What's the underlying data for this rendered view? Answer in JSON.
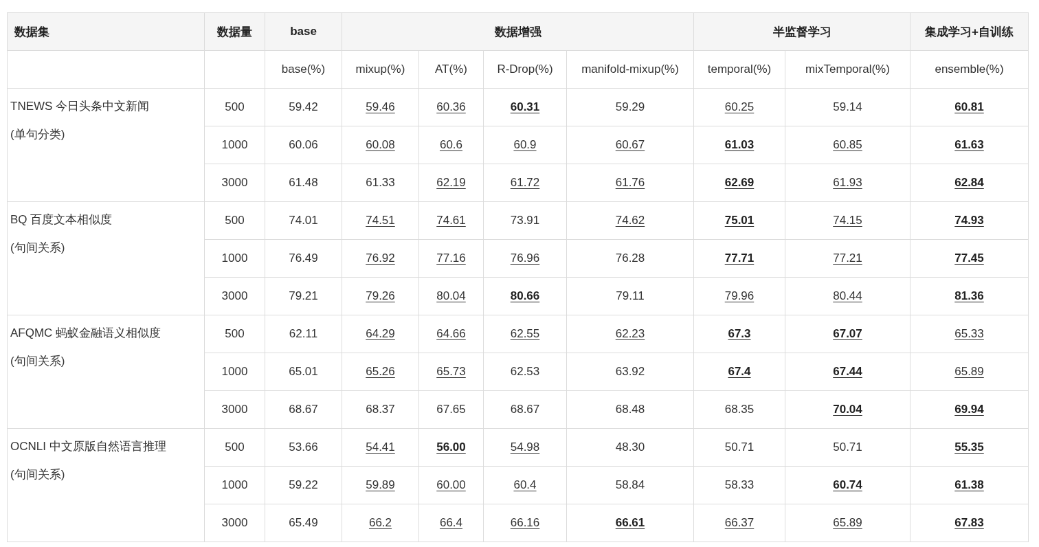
{
  "table": {
    "column_groups": [
      {
        "title": "数据集"
      },
      {
        "title": "数据量"
      },
      {
        "title": "base",
        "columns": [
          "base(%)"
        ]
      },
      {
        "title": "数据增强",
        "columns": [
          "mixup(%)",
          "AT(%)",
          "R-Drop(%)",
          "manifold-mixup(%)"
        ]
      },
      {
        "title": "半监督学习",
        "columns": [
          "temporal(%)",
          "mixTemporal(%)"
        ]
      },
      {
        "title": "集成学习+自训练",
        "columns": [
          "ensemble(%)"
        ]
      }
    ],
    "datasets": [
      {
        "name": "TNEWS 今日头条中文新闻",
        "category": "(单句分类)",
        "rows": [
          {
            "size": "500",
            "values": [
              {
                "text": "59.42",
                "bold": false,
                "underlined": false
              },
              {
                "text": "59.46",
                "bold": false,
                "underlined": true
              },
              {
                "text": "60.36",
                "bold": false,
                "underlined": true
              },
              {
                "text": "60.31",
                "bold": true,
                "underlined": true
              },
              {
                "text": "59.29",
                "bold": false,
                "underlined": false
              },
              {
                "text": "60.25",
                "bold": false,
                "underlined": true
              },
              {
                "text": "59.14",
                "bold": false,
                "underlined": false
              },
              {
                "text": "60.81",
                "bold": true,
                "underlined": true
              }
            ]
          },
          {
            "size": "1000",
            "values": [
              {
                "text": "60.06",
                "bold": false,
                "underlined": false
              },
              {
                "text": "60.08",
                "bold": false,
                "underlined": true
              },
              {
                "text": "60.6",
                "bold": false,
                "underlined": true
              },
              {
                "text": "60.9",
                "bold": false,
                "underlined": true
              },
              {
                "text": "60.67",
                "bold": false,
                "underlined": true
              },
              {
                "text": "61.03",
                "bold": true,
                "underlined": true
              },
              {
                "text": "60.85",
                "bold": false,
                "underlined": true
              },
              {
                "text": "61.63",
                "bold": true,
                "underlined": true
              }
            ]
          },
          {
            "size": "3000",
            "values": [
              {
                "text": "61.48",
                "bold": false,
                "underlined": false
              },
              {
                "text": "61.33",
                "bold": false,
                "underlined": false
              },
              {
                "text": "62.19",
                "bold": false,
                "underlined": true
              },
              {
                "text": "61.72",
                "bold": false,
                "underlined": true
              },
              {
                "text": "61.76",
                "bold": false,
                "underlined": true
              },
              {
                "text": "62.69",
                "bold": true,
                "underlined": true
              },
              {
                "text": "61.93",
                "bold": false,
                "underlined": true
              },
              {
                "text": "62.84",
                "bold": true,
                "underlined": true
              }
            ]
          }
        ]
      },
      {
        "name": "BQ 百度文本相似度",
        "category": "(句间关系)",
        "rows": [
          {
            "size": "500",
            "values": [
              {
                "text": "74.01",
                "bold": false,
                "underlined": false
              },
              {
                "text": "74.51",
                "bold": false,
                "underlined": true
              },
              {
                "text": "74.61",
                "bold": false,
                "underlined": true
              },
              {
                "text": "73.91",
                "bold": false,
                "underlined": false
              },
              {
                "text": "74.62",
                "bold": false,
                "underlined": true
              },
              {
                "text": "75.01",
                "bold": true,
                "underlined": true
              },
              {
                "text": "74.15",
                "bold": false,
                "underlined": true
              },
              {
                "text": "74.93",
                "bold": true,
                "underlined": true
              }
            ]
          },
          {
            "size": "1000",
            "values": [
              {
                "text": "76.49",
                "bold": false,
                "underlined": false
              },
              {
                "text": "76.92",
                "bold": false,
                "underlined": true
              },
              {
                "text": "77.16",
                "bold": false,
                "underlined": true
              },
              {
                "text": "76.96",
                "bold": false,
                "underlined": true
              },
              {
                "text": "76.28",
                "bold": false,
                "underlined": false
              },
              {
                "text": "77.71",
                "bold": true,
                "underlined": true
              },
              {
                "text": "77.21",
                "bold": false,
                "underlined": true
              },
              {
                "text": "77.45",
                "bold": true,
                "underlined": true
              }
            ]
          },
          {
            "size": "3000",
            "values": [
              {
                "text": "79.21",
                "bold": false,
                "underlined": false
              },
              {
                "text": "79.26",
                "bold": false,
                "underlined": true
              },
              {
                "text": "80.04",
                "bold": false,
                "underlined": true
              },
              {
                "text": "80.66",
                "bold": true,
                "underlined": true
              },
              {
                "text": "79.11",
                "bold": false,
                "underlined": false
              },
              {
                "text": "79.96",
                "bold": false,
                "underlined": true
              },
              {
                "text": "80.44",
                "bold": false,
                "underlined": true
              },
              {
                "text": "81.36",
                "bold": true,
                "underlined": true
              }
            ]
          }
        ]
      },
      {
        "name": "AFQMC 蚂蚁金融语义相似度",
        "category": "(句间关系)",
        "rows": [
          {
            "size": "500",
            "values": [
              {
                "text": "62.11",
                "bold": false,
                "underlined": false
              },
              {
                "text": "64.29",
                "bold": false,
                "underlined": true
              },
              {
                "text": "64.66",
                "bold": false,
                "underlined": true
              },
              {
                "text": "62.55",
                "bold": false,
                "underlined": true
              },
              {
                "text": "62.23",
                "bold": false,
                "underlined": true
              },
              {
                "text": "67.3",
                "bold": true,
                "underlined": true
              },
              {
                "text": "67.07",
                "bold": true,
                "underlined": true
              },
              {
                "text": "65.33",
                "bold": false,
                "underlined": true
              }
            ]
          },
          {
            "size": "1000",
            "values": [
              {
                "text": "65.01",
                "bold": false,
                "underlined": false
              },
              {
                "text": "65.26",
                "bold": false,
                "underlined": true
              },
              {
                "text": "65.73",
                "bold": false,
                "underlined": true
              },
              {
                "text": "62.53",
                "bold": false,
                "underlined": false
              },
              {
                "text": "63.92",
                "bold": false,
                "underlined": false
              },
              {
                "text": "67.4",
                "bold": true,
                "underlined": true
              },
              {
                "text": "67.44",
                "bold": true,
                "underlined": true
              },
              {
                "text": "65.89",
                "bold": false,
                "underlined": true
              }
            ]
          },
          {
            "size": "3000",
            "values": [
              {
                "text": "68.67",
                "bold": false,
                "underlined": false
              },
              {
                "text": "68.37",
                "bold": false,
                "underlined": false
              },
              {
                "text": "67.65",
                "bold": false,
                "underlined": false
              },
              {
                "text": "68.67",
                "bold": false,
                "underlined": false
              },
              {
                "text": "68.48",
                "bold": false,
                "underlined": false
              },
              {
                "text": "68.35",
                "bold": false,
                "underlined": false
              },
              {
                "text": "70.04",
                "bold": true,
                "underlined": true
              },
              {
                "text": "69.94",
                "bold": true,
                "underlined": true
              }
            ]
          }
        ]
      },
      {
        "name": "OCNLI 中文原版自然语言推理",
        "category": "(句间关系)",
        "rows": [
          {
            "size": "500",
            "values": [
              {
                "text": "53.66",
                "bold": false,
                "underlined": false
              },
              {
                "text": "54.41",
                "bold": false,
                "underlined": true
              },
              {
                "text": "56.00",
                "bold": true,
                "underlined": true
              },
              {
                "text": "54.98",
                "bold": false,
                "underlined": true
              },
              {
                "text": "48.30",
                "bold": false,
                "underlined": false
              },
              {
                "text": "50.71",
                "bold": false,
                "underlined": false
              },
              {
                "text": "50.71",
                "bold": false,
                "underlined": false
              },
              {
                "text": "55.35",
                "bold": true,
                "underlined": true
              }
            ]
          },
          {
            "size": "1000",
            "values": [
              {
                "text": "59.22",
                "bold": false,
                "underlined": false
              },
              {
                "text": "59.89",
                "bold": false,
                "underlined": true
              },
              {
                "text": "60.00",
                "bold": false,
                "underlined": true
              },
              {
                "text": "60.4",
                "bold": false,
                "underlined": true
              },
              {
                "text": "58.84",
                "bold": false,
                "underlined": false
              },
              {
                "text": "58.33",
                "bold": false,
                "underlined": false
              },
              {
                "text": "60.74",
                "bold": true,
                "underlined": true
              },
              {
                "text": "61.38",
                "bold": true,
                "underlined": true
              }
            ]
          },
          {
            "size": "3000",
            "values": [
              {
                "text": "65.49",
                "bold": false,
                "underlined": false
              },
              {
                "text": "66.2",
                "bold": false,
                "underlined": true
              },
              {
                "text": "66.4",
                "bold": false,
                "underlined": true
              },
              {
                "text": "66.16",
                "bold": false,
                "underlined": true
              },
              {
                "text": "66.61",
                "bold": true,
                "underlined": true
              },
              {
                "text": "66.37",
                "bold": false,
                "underlined": true
              },
              {
                "text": "65.89",
                "bold": false,
                "underlined": true
              },
              {
                "text": "67.83",
                "bold": true,
                "underlined": true
              }
            ]
          }
        ]
      }
    ]
  }
}
